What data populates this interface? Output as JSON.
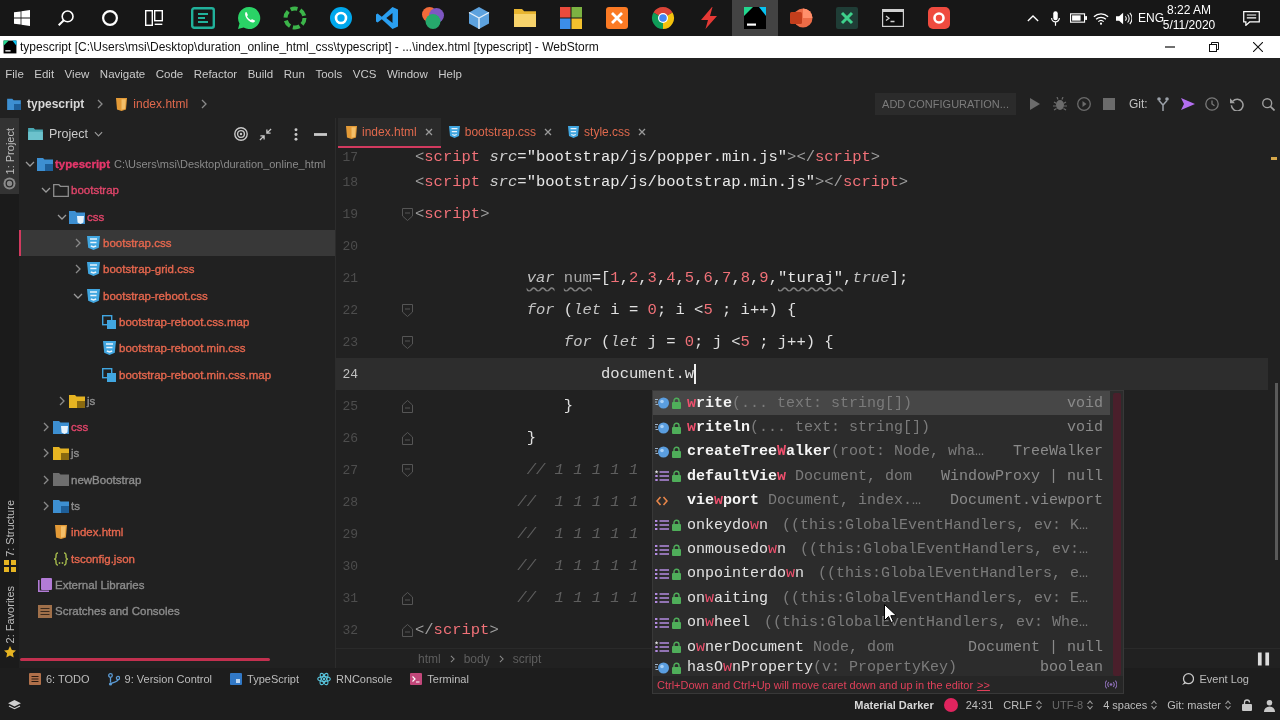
{
  "taskbar": {
    "pinned": [
      {
        "selected": false
      },
      {
        "selected": false
      },
      {
        "selected": false
      },
      {
        "selected": false
      },
      {
        "selected": false
      },
      {
        "selected": false
      },
      {
        "selected": false
      },
      {
        "selected": false
      },
      {
        "selected": false
      },
      {
        "selected": false
      },
      {
        "selected": false
      },
      {
        "selected": false
      },
      {
        "selected": true
      },
      {
        "selected": false
      },
      {
        "selected": false
      },
      {
        "selected": false
      },
      {
        "selected": false
      }
    ],
    "language": "ENG",
    "time": "8:22 AM",
    "date": "5/11/2020"
  },
  "window": {
    "title": "typescript [C:\\Users\\msi\\Desktop\\duration_online_html_css\\typescript] - ...\\index.html [typescript] - WebStorm"
  },
  "menu": [
    "File",
    "Edit",
    "View",
    "Navigate",
    "Code",
    "Refactor",
    "Build",
    "Run",
    "Tools",
    "VCS",
    "Window",
    "Help"
  ],
  "navigation": {
    "breadcrumbs": [
      {
        "kind": "project",
        "label": "typescript"
      },
      {
        "kind": "html",
        "label": "index.html"
      }
    ],
    "run_configuration": "ADD CONFIGURATION...",
    "vcs_label": "Git:"
  },
  "tool_stripe": [
    {
      "label": "1: Project",
      "selected": true
    },
    {
      "label": "7: Structure",
      "selected": false
    },
    {
      "label": "2: Favorites",
      "selected": false
    }
  ],
  "project_panel": {
    "title": "Project",
    "tree": [
      {
        "kind": "project",
        "label": "typescript",
        "path": "C:\\Users\\msi\\Desktop\\duration_online_html",
        "color": "#e5376b",
        "expanded": true,
        "selected": false,
        "children": [
          {
            "kind": "folder",
            "label": "bootstrap",
            "color": "#e0456a",
            "expanded": true,
            "selected": false,
            "children": [
              {
                "kind": "css-folder",
                "label": "css",
                "color": "#e0456a",
                "expanded": true,
                "selected": false,
                "children": [
                  {
                    "kind": "css",
                    "label": "bootstrap.css",
                    "color": "#e6674e",
                    "expanded": false,
                    "selected": true
                  },
                  {
                    "kind": "css",
                    "label": "bootstrap-grid.css",
                    "color": "#e6674e",
                    "expanded": false,
                    "selected": false
                  },
                  {
                    "kind": "css",
                    "label": "bootstrap-reboot.css",
                    "color": "#e6674e",
                    "expanded": true,
                    "selected": false,
                    "children": [
                      {
                        "kind": "map",
                        "label": "bootstrap-reboot.css.map",
                        "color": "#e6674e",
                        "selected": false
                      },
                      {
                        "kind": "css",
                        "label": "bootstrap-reboot.min.css",
                        "color": "#e6674e",
                        "selected": false
                      },
                      {
                        "kind": "map",
                        "label": "bootstrap-reboot.min.css.map",
                        "color": "#e6674e",
                        "selected": false
                      }
                    ]
                  }
                ]
              },
              {
                "kind": "js-folder",
                "label": "js",
                "color": "#8e8e8e",
                "expanded": false,
                "selected": false
              }
            ]
          },
          {
            "kind": "css-folder",
            "label": "css",
            "color": "#e0456a",
            "expanded": false,
            "selected": false
          },
          {
            "kind": "js-folder",
            "label": "js",
            "color": "#8e8e8e",
            "expanded": false,
            "selected": false
          },
          {
            "kind": "plain-folder",
            "label": "newBootstrap",
            "color": "#8e8e8e",
            "expanded": false,
            "selected": false
          },
          {
            "kind": "ts-folder",
            "label": "ts",
            "color": "#8e8e8e",
            "expanded": false,
            "selected": false
          },
          {
            "kind": "html",
            "label": "index.html",
            "color": "#e6674e",
            "selected": false
          },
          {
            "kind": "json",
            "label": "tsconfig.json",
            "color": "#e6674e",
            "selected": false
          }
        ]
      },
      {
        "kind": "library",
        "label": "External Libraries",
        "color": "#8c8c8c",
        "selected": false
      },
      {
        "kind": "scratches",
        "label": "Scratches and Consoles",
        "color": "#8c8c8c",
        "selected": false
      }
    ]
  },
  "editor": {
    "tabs": [
      {
        "kind": "html",
        "label": "index.html",
        "selected": true
      },
      {
        "kind": "css",
        "label": "bootstrap.css",
        "selected": false
      },
      {
        "kind": "css",
        "label": "style.css",
        "selected": false
      }
    ],
    "lines": [
      {
        "number": "17",
        "current": false,
        "fold_start": false,
        "fold_end": false,
        "tokens": [
          {
            "kind": "punct",
            "text": "<"
          },
          {
            "kind": "tag",
            "text": "script"
          },
          {
            "kind": "attr",
            "text": " src"
          },
          {
            "kind": "plain",
            "text": "="
          },
          {
            "kind": "string",
            "text": "\"bootstrap/js/popper.min.js\""
          },
          {
            "kind": "punct",
            "text": "></"
          },
          {
            "kind": "tag",
            "text": "script"
          },
          {
            "kind": "punct",
            "text": ">"
          }
        ]
      },
      {
        "number": "18",
        "current": false,
        "fold_start": false,
        "fold_end": false,
        "tokens": [
          {
            "kind": "punct",
            "text": "<"
          },
          {
            "kind": "tag",
            "text": "script"
          },
          {
            "kind": "attr",
            "text": " src"
          },
          {
            "kind": "plain",
            "text": "="
          },
          {
            "kind": "string",
            "text": "\"bootstrap/js/bootstrap.min.js\""
          },
          {
            "kind": "punct",
            "text": "></"
          },
          {
            "kind": "tag",
            "text": "script"
          },
          {
            "kind": "punct",
            "text": ">"
          }
        ]
      },
      {
        "number": "19",
        "current": false,
        "fold_start": true,
        "fold_end": false,
        "tokens": [
          {
            "kind": "punct",
            "text": "<"
          },
          {
            "kind": "tag",
            "text": "script"
          },
          {
            "kind": "punct",
            "text": ">"
          }
        ]
      },
      {
        "number": "20",
        "current": false,
        "fold_start": false,
        "fold_end": false
      },
      {
        "number": "21",
        "current": false,
        "fold_start": false,
        "fold_end": false,
        "tokens": [
          {
            "kind": "keyword",
            "text": "            var",
            "warning": true
          },
          {
            "kind": "variable",
            "text": " num",
            "warning": true
          },
          {
            "kind": "plain",
            "text": "=[",
            "warning": false
          },
          {
            "kind": "number",
            "text": "1",
            "warning": false
          },
          {
            "kind": "plain",
            "text": ",",
            "warning": false
          },
          {
            "kind": "number",
            "text": "2",
            "warning": false
          },
          {
            "kind": "plain",
            "text": ",",
            "warning": false
          },
          {
            "kind": "number",
            "text": "3",
            "warning": false
          },
          {
            "kind": "plain",
            "text": ",",
            "warning": false
          },
          {
            "kind": "number",
            "text": "4",
            "warning": false
          },
          {
            "kind": "plain",
            "text": ",",
            "warning": false
          },
          {
            "kind": "number",
            "text": "5",
            "warning": false
          },
          {
            "kind": "plain",
            "text": ",",
            "warning": false
          },
          {
            "kind": "number",
            "text": "6",
            "warning": false
          },
          {
            "kind": "plain",
            "text": ",",
            "warning": false
          },
          {
            "kind": "number",
            "text": "7",
            "warning": false
          },
          {
            "kind": "plain",
            "text": ",",
            "warning": false
          },
          {
            "kind": "number",
            "text": "8",
            "warning": false
          },
          {
            "kind": "plain",
            "text": ",",
            "warning": false
          },
          {
            "kind": "number",
            "text": "9",
            "warning": false
          },
          {
            "kind": "plain",
            "text": ",",
            "warning": false
          },
          {
            "kind": "string",
            "text": "\"turaj\"",
            "warning": true
          },
          {
            "kind": "plain",
            "text": ",",
            "warning": false
          },
          {
            "kind": "keyword",
            "text": "true",
            "warning": false
          },
          {
            "kind": "plain",
            "text": "];",
            "warning": false
          }
        ]
      },
      {
        "number": "22",
        "current": false,
        "fold_start": true,
        "fold_end": false,
        "tokens": [
          {
            "kind": "keyword",
            "text": "            for"
          },
          {
            "kind": "plain",
            "text": " ("
          },
          {
            "kind": "keyword",
            "text": "let"
          },
          {
            "kind": "plain",
            "text": " i = "
          },
          {
            "kind": "number",
            "text": "0"
          },
          {
            "kind": "plain",
            "text": "; i <"
          },
          {
            "kind": "number",
            "text": "5"
          },
          {
            "kind": "plain",
            "text": " ; i++) {"
          }
        ]
      },
      {
        "number": "23",
        "current": false,
        "fold_start": true,
        "fold_end": false,
        "tokens": [
          {
            "kind": "keyword",
            "text": "                for"
          },
          {
            "kind": "plain",
            "text": " ("
          },
          {
            "kind": "keyword",
            "text": "let"
          },
          {
            "kind": "plain",
            "text": " j = "
          },
          {
            "kind": "number",
            "text": "0"
          },
          {
            "kind": "plain",
            "text": "; j <"
          },
          {
            "kind": "number",
            "text": "5"
          },
          {
            "kind": "plain",
            "text": " ; j++) {"
          }
        ]
      },
      {
        "number": "24",
        "current": true,
        "fold_start": false,
        "fold_end": false,
        "tokens": [
          {
            "kind": "plain",
            "text": "                    document.w"
          }
        ]
      },
      {
        "number": "25",
        "current": false,
        "fold_start": false,
        "fold_end": true,
        "tokens": [
          {
            "kind": "plain",
            "text": "                }"
          }
        ]
      },
      {
        "number": "26",
        "current": false,
        "fold_start": false,
        "fold_end": true,
        "tokens": [
          {
            "kind": "plain",
            "text": "            }"
          }
        ]
      },
      {
        "number": "27",
        "current": false,
        "fold_start": true,
        "fold_end": false,
        "tokens": [
          {
            "kind": "comment",
            "text": "            // 1 1 1 1 1"
          }
        ]
      },
      {
        "number": "28",
        "current": false,
        "fold_start": false,
        "fold_end": false,
        "tokens": [
          {
            "kind": "comment",
            "text": "           //  1 1 1 1 1"
          }
        ]
      },
      {
        "number": "29",
        "current": false,
        "fold_start": false,
        "fold_end": false,
        "tokens": [
          {
            "kind": "comment",
            "text": "           //  1 1 1 1 1"
          }
        ]
      },
      {
        "number": "30",
        "current": false,
        "fold_start": false,
        "fold_end": false,
        "tokens": [
          {
            "kind": "comment",
            "text": "           //  1 1 1 1 1"
          }
        ]
      },
      {
        "number": "31",
        "current": false,
        "fold_start": false,
        "fold_end": true,
        "tokens": [
          {
            "kind": "comment",
            "text": "           //  1 1 1 1 1"
          }
        ]
      },
      {
        "number": "32",
        "current": false,
        "fold_start": false,
        "fold_end": true,
        "tokens": [
          {
            "kind": "punct",
            "text": "</"
          },
          {
            "kind": "tag",
            "text": "script"
          },
          {
            "kind": "punct",
            "text": ">"
          }
        ]
      }
    ],
    "breadcrumb": [
      "html",
      "body",
      "script"
    ],
    "completion": {
      "items": [
        {
          "kind": "method",
          "locked": true,
          "bold": true,
          "selected": true,
          "name": [
            {
              "text": "w",
              "match": true
            },
            {
              "text": "rite",
              "match": false
            }
          ],
          "detail": "(... text: string[])",
          "type": "void"
        },
        {
          "kind": "method",
          "locked": true,
          "bold": true,
          "selected": false,
          "name": [
            {
              "text": "w",
              "match": true
            },
            {
              "text": "riteln",
              "match": false
            }
          ],
          "detail": "(... text: string[])",
          "type": "void"
        },
        {
          "kind": "method",
          "locked": true,
          "bold": true,
          "selected": false,
          "name": [
            {
              "text": "createTree",
              "match": false
            },
            {
              "text": "W",
              "match": true
            },
            {
              "text": "alker",
              "match": false
            }
          ],
          "detail": "(root: Node, wha…",
          "type": "TreeWalker"
        },
        {
          "kind": "getter",
          "locked": true,
          "bold": true,
          "selected": false,
          "name": [
            {
              "text": "defaultVie",
              "match": false
            },
            {
              "text": "w",
              "match": true
            }
          ],
          "detail": "Document, dom",
          "type": "WindowProxy | null"
        },
        {
          "kind": "tag",
          "locked": false,
          "bold": true,
          "selected": false,
          "name": [
            {
              "text": "vie",
              "match": false
            },
            {
              "text": "w",
              "match": true
            },
            {
              "text": "port",
              "match": false
            }
          ],
          "detail": "Document, index.…",
          "type": "Document.viewport"
        },
        {
          "kind": "property",
          "locked": true,
          "bold": false,
          "selected": false,
          "name": [
            {
              "text": "onkeydo",
              "match": false
            },
            {
              "text": "w",
              "match": true
            },
            {
              "text": "n",
              "match": false
            }
          ],
          "detail": "((this:GlobalEventHandlers, ev: K…"
        },
        {
          "kind": "property",
          "locked": true,
          "bold": false,
          "selected": false,
          "name": [
            {
              "text": "onmousedo",
              "match": false
            },
            {
              "text": "w",
              "match": true
            },
            {
              "text": "n",
              "match": false
            }
          ],
          "detail": "((this:GlobalEventHandlers, ev:…"
        },
        {
          "kind": "property",
          "locked": true,
          "bold": false,
          "selected": false,
          "name": [
            {
              "text": "onpointerdo",
              "match": false
            },
            {
              "text": "w",
              "match": true
            },
            {
              "text": "n",
              "match": false
            }
          ],
          "detail": "((this:GlobalEventHandlers, e…"
        },
        {
          "kind": "property",
          "locked": true,
          "bold": false,
          "selected": false,
          "name": [
            {
              "text": "on",
              "match": false
            },
            {
              "text": "w",
              "match": true
            },
            {
              "text": "aiting",
              "match": false
            }
          ],
          "detail": "((this:GlobalEventHandlers, ev: E…"
        },
        {
          "kind": "property",
          "locked": true,
          "bold": false,
          "selected": false,
          "name": [
            {
              "text": "on",
              "match": false
            },
            {
              "text": "w",
              "match": true
            },
            {
              "text": "heel",
              "match": false
            }
          ],
          "detail": "((this:GlobalEventHandlers, ev: Whe…"
        },
        {
          "kind": "getter",
          "locked": true,
          "bold": false,
          "selected": false,
          "name": [
            {
              "text": "o",
              "match": false
            },
            {
              "text": "w",
              "match": true
            },
            {
              "text": "nerDocument",
              "match": false
            }
          ],
          "detail": "Node, dom",
          "type": "Document | null"
        },
        {
          "kind": "method",
          "locked": true,
          "bold": false,
          "selected": false,
          "name": [
            {
              "text": "hasO",
              "match": false
            },
            {
              "text": "w",
              "match": true
            },
            {
              "text": "nProperty",
              "match": false
            }
          ],
          "detail": "(v: PropertyKey)",
          "type": "boolean"
        }
      ],
      "hint": "Ctrl+Down and Ctrl+Up will move caret down and up in the editor",
      "hint_link": ">>"
    }
  },
  "tool_windows": [
    {
      "label": "6: TODO"
    },
    {
      "label": "9: Version Control"
    },
    {
      "label": "TypeScript"
    },
    {
      "label": "RNConsole"
    },
    {
      "label": "Terminal"
    }
  ],
  "event_log": "Event Log",
  "status_bar": {
    "theme": "Material Darker",
    "widgets": [
      {
        "label": "24:31",
        "dropdown": false,
        "disabled": false
      },
      {
        "label": "CRLF",
        "dropdown": true,
        "disabled": false
      },
      {
        "label": "UTF-8",
        "dropdown": true,
        "disabled": true
      },
      {
        "label": "4 spaces",
        "dropdown": true,
        "disabled": false
      },
      {
        "label": "Git: master",
        "dropdown": true,
        "disabled": false
      }
    ]
  }
}
